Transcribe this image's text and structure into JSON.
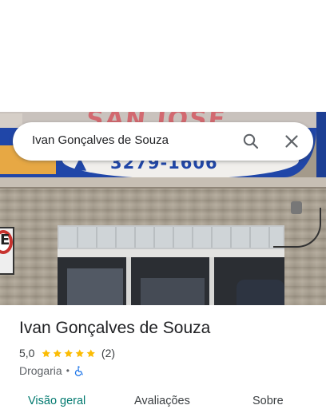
{
  "search": {
    "query": "Ivan Gonçalves de Souza"
  },
  "photo": {
    "sign_top_text": "SAN JOSE",
    "sign_phone": "3279-1606",
    "plate_letter": "E"
  },
  "place": {
    "name": "Ivan Gonçalves de Souza",
    "rating": "5,0",
    "stars": 5,
    "review_count": "(2)",
    "category": "Drogaria",
    "separator": "•",
    "accessibility_icon": "wheelchair-icon"
  },
  "tabs": [
    {
      "label": "Visão geral",
      "active": true
    },
    {
      "label": "Avaliações",
      "active": false
    },
    {
      "label": "Sobre",
      "active": false
    }
  ],
  "colors": {
    "star": "#fbbc04",
    "active_tab": "#01796f",
    "accessibility": "#1a73e8"
  }
}
